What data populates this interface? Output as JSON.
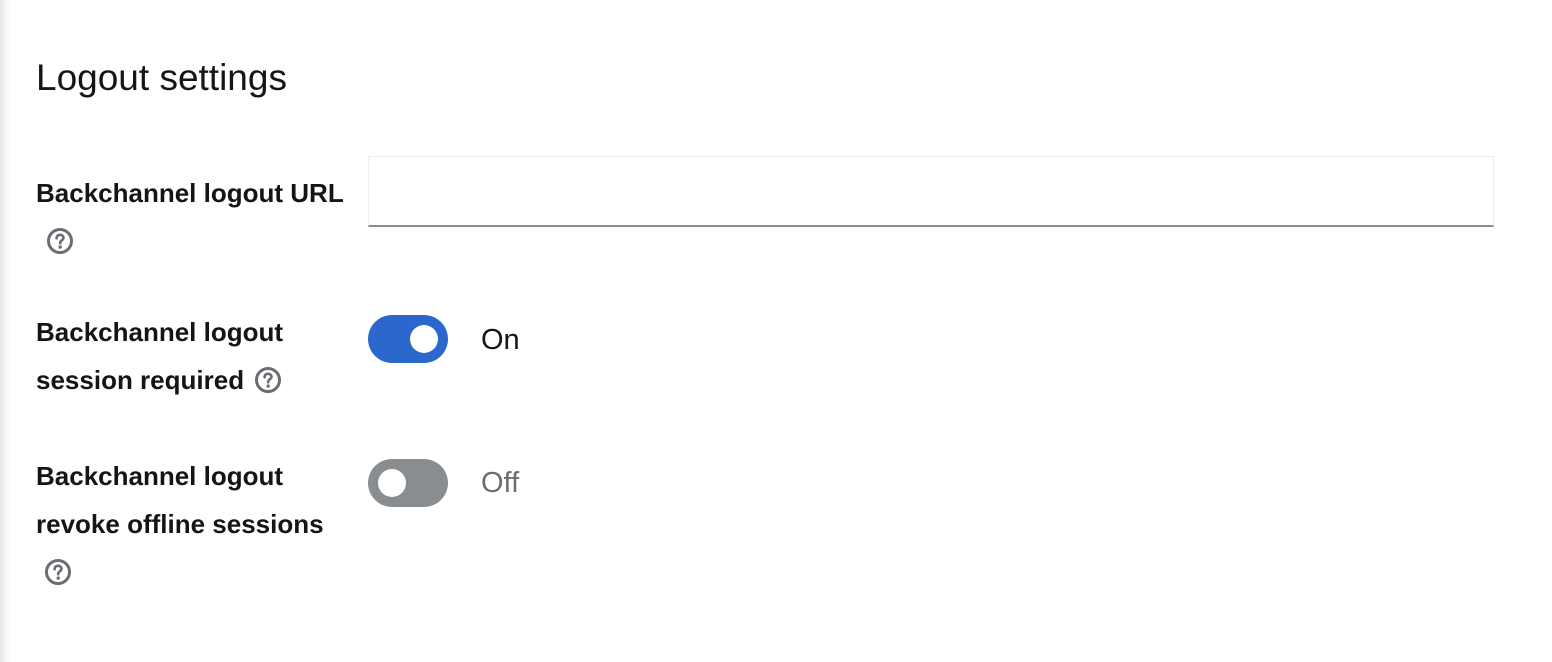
{
  "section": {
    "title": "Logout settings"
  },
  "fields": {
    "backchannel_url": {
      "label": "Backchannel logout URL",
      "value": "",
      "placeholder": "",
      "help_icon": "question-circle-icon"
    },
    "session_required": {
      "label": "Backchannel logout session required",
      "state": "On",
      "enabled": true,
      "help_icon": "question-circle-icon"
    },
    "revoke_offline": {
      "label": "Backchannel logout revoke offline sessions",
      "state": "Off",
      "enabled": false,
      "help_icon": "question-circle-icon"
    }
  },
  "colors": {
    "switch_on": "#2b67cc",
    "switch_off": "#8a8d90",
    "text": "#151515",
    "muted_text": "#6a6e73"
  }
}
